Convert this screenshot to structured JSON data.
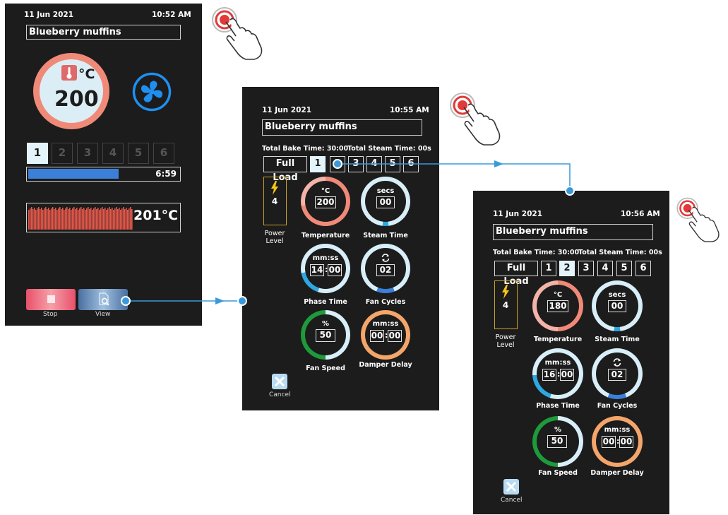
{
  "screens": [
    {
      "date": "11 Jun 2021",
      "time": "10:52 AM",
      "recipe": "Blueberry muffins",
      "temp_unit": "°C",
      "temp_value": "200",
      "steps": [
        "1",
        "2",
        "3",
        "4",
        "5",
        "6"
      ],
      "selected_step": "1",
      "progress": 0.6,
      "remaining": "6:59",
      "current_temp": "201°C",
      "stop_label": "Stop",
      "view_label": "View"
    },
    {
      "date": "11 Jun 2021",
      "time": "10:55 AM",
      "recipe": "Blueberry muffins",
      "total_bake": "Total Bake Time: 30:00",
      "total_steam": "Total Steam Time: 00s",
      "full_load": "Full Load",
      "steps": [
        "1",
        "2",
        "3",
        "4",
        "5",
        "6"
      ],
      "selected_step": "1",
      "power_value": "4",
      "power_label": "Power Level",
      "temperature": {
        "unit": "°C",
        "value": "200",
        "label": "Temperature"
      },
      "steam": {
        "unit": "secs",
        "value": "00",
        "label": "Steam Time"
      },
      "phase": {
        "unit": "mm:ss",
        "mm": "14",
        "ss": "00",
        "label": "Phase Time"
      },
      "fan_cycles": {
        "value": "02",
        "label": "Fan Cycles"
      },
      "fan_speed": {
        "unit": "%",
        "value": "50",
        "label": "Fan Speed"
      },
      "damper": {
        "unit": "mm:ss",
        "mm": "00",
        "ss": "00",
        "label": "Damper Delay"
      },
      "cancel_label": "Cancel"
    },
    {
      "date": "11 Jun 2021",
      "time": "10:56 AM",
      "recipe": "Blueberry muffins",
      "total_bake": "Total Bake Time: 30:00",
      "total_steam": "Total Steam Time: 00s",
      "full_load": "Full Load",
      "steps": [
        "1",
        "2",
        "3",
        "4",
        "5",
        "6"
      ],
      "selected_step": "2",
      "power_value": "4",
      "power_label": "Power Level",
      "temperature": {
        "unit": "°C",
        "value": "180",
        "label": "Temperature"
      },
      "steam": {
        "unit": "secs",
        "value": "00",
        "label": "Steam Time"
      },
      "phase": {
        "unit": "mm:ss",
        "mm": "16",
        "ss": "00",
        "label": "Phase Time"
      },
      "fan_cycles": {
        "value": "02",
        "label": "Fan Cycles"
      },
      "fan_speed": {
        "unit": "%",
        "value": "50",
        "label": "Fan Speed"
      },
      "damper": {
        "unit": "mm:ss",
        "mm": "00",
        "ss": "00",
        "label": "Damper Delay"
      },
      "cancel_label": "Cancel"
    }
  ],
  "colors": {
    "background": "#1c1c1c",
    "temperature_ring": "#f08a78",
    "ring_light": "#d8eef8",
    "accent_blue": "#2ea7e0",
    "fan_green": "#1e9a3a",
    "damper_orange": "#f4a56a",
    "power_yellow": "#f5c518",
    "progress_blue": "#3b7fd9",
    "stop_red": "#e95a6a"
  },
  "icons": [
    "thermometer-icon",
    "fan-icon",
    "stop-icon",
    "view-icon",
    "lightning-icon",
    "fan-cycle-icon",
    "cancel-icon",
    "tap-hand-icon"
  ]
}
